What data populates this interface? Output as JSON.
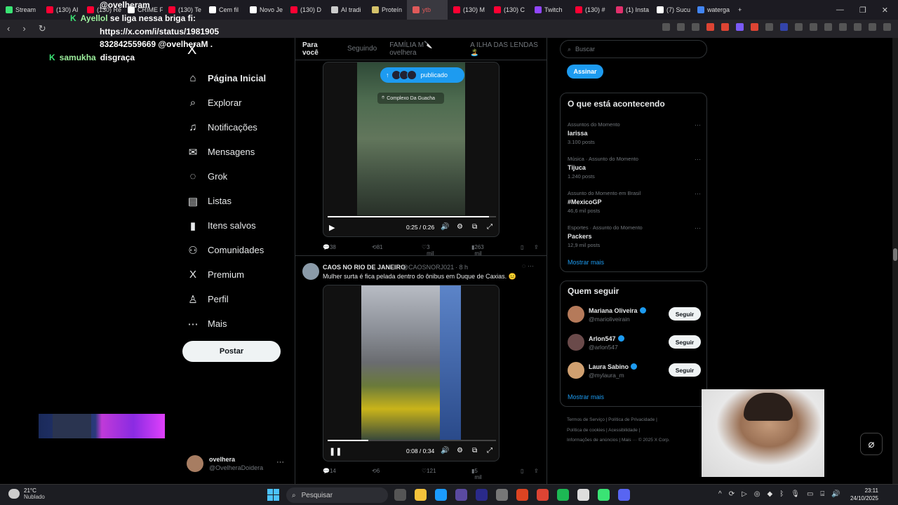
{
  "browser": {
    "tabs": [
      {
        "label": "Stream",
        "color": "#3ae374"
      },
      {
        "label": "(130) AI",
        "color": "#ff0033"
      },
      {
        "label": "(130) Re",
        "color": "#ff0033"
      },
      {
        "label": "CRIME F",
        "color": "#ffffff"
      },
      {
        "label": "(130) Te",
        "color": "#ff0033"
      },
      {
        "label": "Cem fil",
        "color": "#ffffff"
      },
      {
        "label": "Novo Je",
        "color": "#ffffff"
      },
      {
        "label": "(130) D",
        "color": "#ff0033"
      },
      {
        "label": "AI tradi",
        "color": "#cccccc"
      },
      {
        "label": "Proteín",
        "color": "#d4c26a"
      },
      {
        "label": "ytb",
        "color": "#e05a5a"
      },
      {
        "label": "(130) M",
        "color": "#ff0033"
      },
      {
        "label": "(130) C",
        "color": "#ff0033"
      },
      {
        "label": "Twitch",
        "color": "#9146ff"
      },
      {
        "label": "(130) #",
        "color": "#ff0033"
      },
      {
        "label": "(1) Insta",
        "color": "#e1306c"
      },
      {
        "label": "(7) Sucu",
        "color": "#ffffff"
      },
      {
        "label": "waterga",
        "color": "#4285f4"
      }
    ],
    "new_tab": "+",
    "nav": {
      "back": "‹",
      "forward": "›",
      "reload": "↻"
    }
  },
  "chat": {
    "line1": "@ovelheram",
    "line2_user": "Ayellol",
    "line2_text": "se liga nessa briga fi:",
    "line3": "https://x.com/i/status/1981905",
    "line4": "832842559669 @ovelheraM .",
    "line5_user": "samukha",
    "line5_text": "disgraça"
  },
  "x_logo": "X",
  "left_nav": [
    {
      "label": "Página Inicial",
      "icon": "⌂"
    },
    {
      "label": "Explorar",
      "icon": "⌕"
    },
    {
      "label": "Notificações",
      "icon": "♫"
    },
    {
      "label": "Mensagens",
      "icon": "✉"
    },
    {
      "label": "Grok",
      "icon": "◌"
    },
    {
      "label": "Listas",
      "icon": "▤"
    },
    {
      "label": "Itens salvos",
      "icon": "▮"
    },
    {
      "label": "Comunidades",
      "icon": "⚇"
    },
    {
      "label": "Premium",
      "icon": "X"
    },
    {
      "label": "Perfil",
      "icon": "♙"
    },
    {
      "label": "Mais",
      "icon": "⋯"
    }
  ],
  "post_button": "Postar",
  "account": {
    "name": "ovelhera",
    "handle": "@OvelheraDoidera",
    "more": "···"
  },
  "feed": {
    "tabs": [
      "Para você",
      "Seguindo",
      "FAMÍLIA M🔪ovelhera",
      "A ILHA DAS LENDAS 🏝️"
    ],
    "post1": {
      "published_label": "publicado",
      "location": "Complexo Da Guacha",
      "time": "0:25 / 0:26",
      "progress": 0.96,
      "replies": "38",
      "reposts": "81",
      "likes": "3 mil",
      "views": "263 mil"
    },
    "post2": {
      "author": "CAOS NO RIO DE JANEIRO",
      "handle": "@CAOSNORJ021",
      "time_ago": "· 8 h",
      "text": "Mulher surta é fica pelada dentro do ônibus em Duque de Caxias. 😐",
      "video_time": "0:08 / 0:34",
      "progress": 0.24,
      "replies": "14",
      "reposts": "6",
      "likes": "121",
      "views": "5 mil"
    }
  },
  "right": {
    "search_placeholder": "Buscar",
    "subscribe": "Assinar",
    "trends_title": "O que está acontecendo",
    "trends": [
      {
        "context": "Assuntos do Momento",
        "name": "Iarissa",
        "count": "3.100 posts"
      },
      {
        "context": "Música · Assunto do Momento",
        "name": "Tijuca",
        "count": "1.240 posts"
      },
      {
        "context": "Assunto do Momento em Brasil",
        "name": "#MexicoGP",
        "count": "46,6 mil posts"
      },
      {
        "context": "Esportes · Assunto do Momento",
        "name": "Packers",
        "count": "12,9 mil posts"
      }
    ],
    "show_more": "Mostrar mais",
    "who_title": "Quem seguir",
    "who": [
      {
        "name": "Mariana Oliveira",
        "handle": "@marioliveirain",
        "button": "Seguir",
        "color": "#b57a5a"
      },
      {
        "name": "Arlon547",
        "handle": "@arlon547",
        "button": "Seguir",
        "color": "#6a4a4a"
      },
      {
        "name": "Laura Sabino",
        "handle": "@mylaura_m",
        "button": "Seguir",
        "color": "#d0a070"
      }
    ],
    "footer": [
      "Termos de Serviço",
      "Política de Privacidade",
      "Política de cookies",
      "Acessibilidade",
      "Informações de anúncios",
      "Mais ···",
      "© 2025 X Corp."
    ]
  },
  "taskbar": {
    "temp": "21°C",
    "weather": "Nublado",
    "search": "Pesquisar",
    "time": "23:11",
    "date": "24/10/2025",
    "apps": [
      "#555",
      "#f5c33b",
      "#1b9cff",
      "#5a4aa0",
      "#2a2a8a",
      "#777",
      "#d42",
      "#d43",
      "#1db954",
      "#ddd",
      "#3ae374",
      "#5865f2"
    ]
  }
}
